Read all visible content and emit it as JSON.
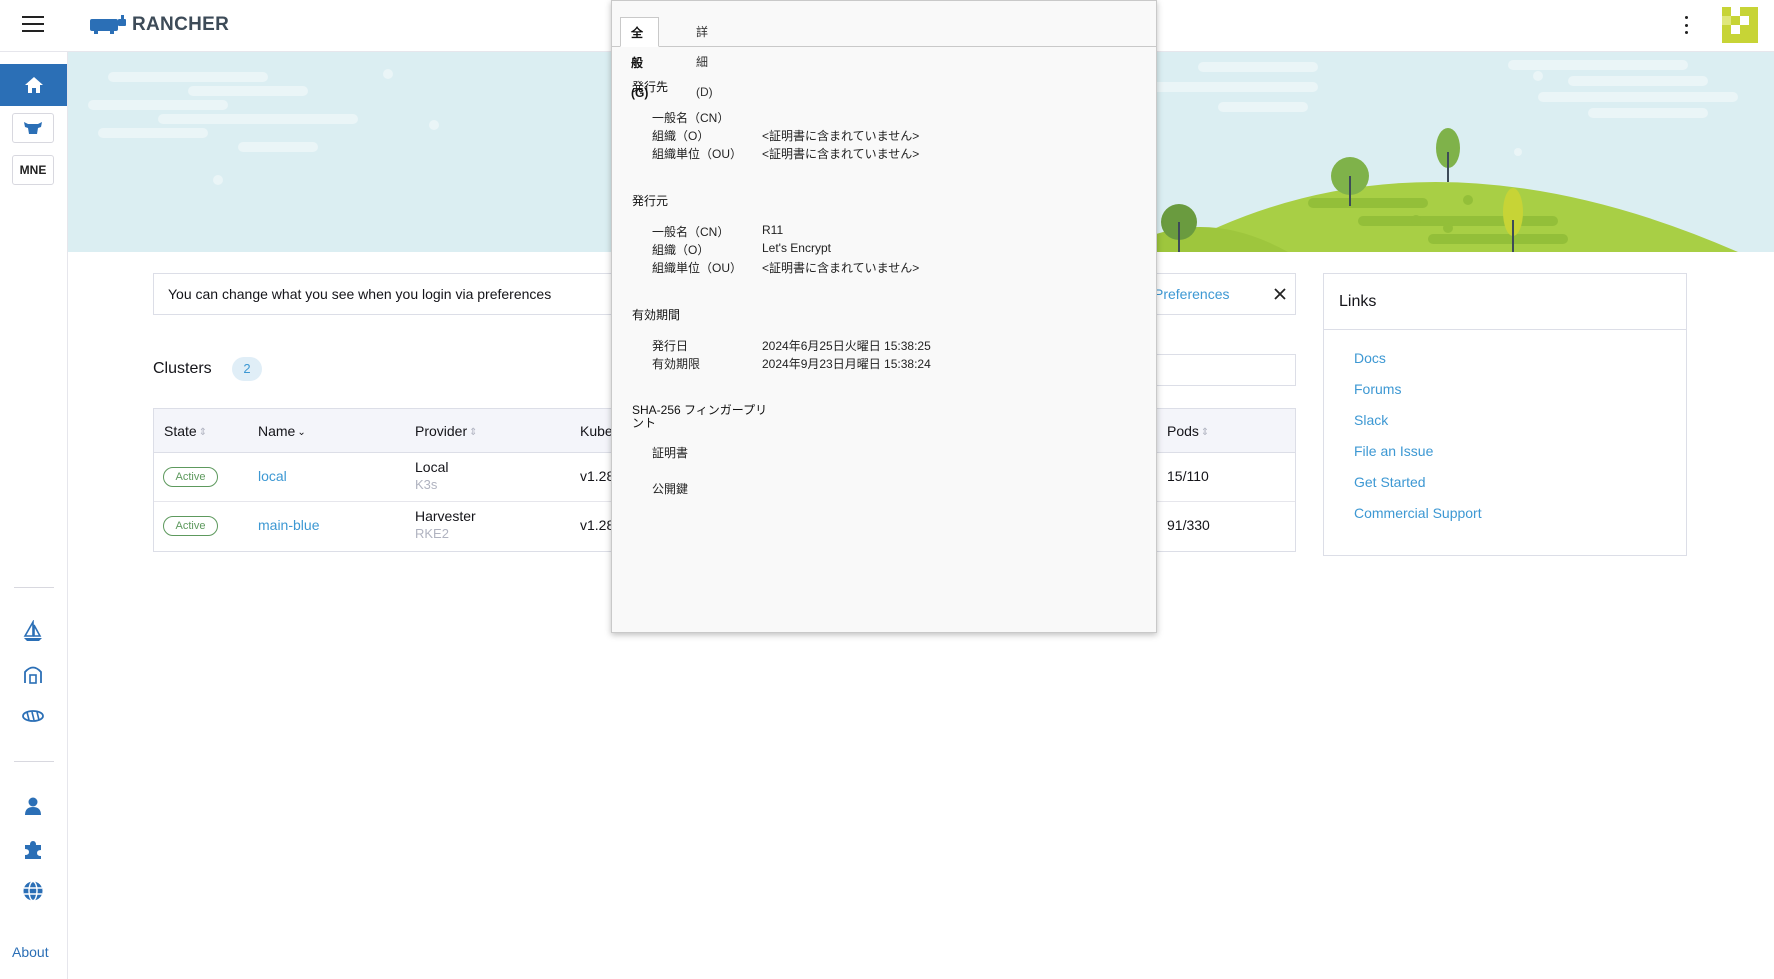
{
  "topbar": {
    "logo_text": "RANCHER"
  },
  "sidebar": {
    "items": [
      {
        "name": "home",
        "label": ""
      },
      {
        "name": "local-cluster",
        "label": ""
      },
      {
        "name": "mne-cluster",
        "label": "MNE"
      }
    ],
    "about_label": "About"
  },
  "notice": {
    "text": "You can change what you see when you login via preferences",
    "link": "Preferences"
  },
  "clusters": {
    "title": "Clusters",
    "count": "2",
    "columns": [
      "State",
      "Name",
      "Provider",
      "Kube",
      "Pods"
    ],
    "rows": [
      {
        "state": "Active",
        "name": "local",
        "provider": "Local",
        "provider_sub": "K3s",
        "kube": "v1.28",
        "pods": "15/110"
      },
      {
        "state": "Active",
        "name": "main-blue",
        "provider": "Harvester",
        "provider_sub": "RKE2",
        "kube": "v1.28",
        "pods": "91/330"
      }
    ]
  },
  "links": {
    "title": "Links",
    "items": [
      "Docs",
      "Forums",
      "Slack",
      "File an Issue",
      "Get Started",
      "Commercial Support"
    ]
  },
  "certificate": {
    "tabs": [
      "全般(G)",
      "詳細(D)"
    ],
    "issued_to": {
      "heading": "発行先",
      "fields": [
        {
          "k": "一般名（CN）",
          "v": ""
        },
        {
          "k": "組織（O）",
          "v": "<証明書に含まれていません>"
        },
        {
          "k": "組織単位（OU）",
          "v": "<証明書に含まれていません>"
        }
      ]
    },
    "issued_by": {
      "heading": "発行元",
      "fields": [
        {
          "k": "一般名（CN）",
          "v": "R11"
        },
        {
          "k": "組織（O）",
          "v": "Let's Encrypt"
        },
        {
          "k": "組織単位（OU）",
          "v": "<証明書に含まれていません>"
        }
      ]
    },
    "validity": {
      "heading": "有効期間",
      "fields": [
        {
          "k": "発行日",
          "v": "2024年6月25日火曜日 15:38:25"
        },
        {
          "k": "有効期限",
          "v": "2024年9月23日月曜日 15:38:24"
        }
      ]
    },
    "fingerprint": {
      "heading_line1": "SHA-256 フィンガープリ",
      "heading_line2": "ント",
      "cert_label": "証明書",
      "key_label": "公開鍵"
    }
  },
  "colors": {
    "accent": "#2b6fb6",
    "link": "#3d98d3",
    "active_badge": "#5d995d",
    "banner": "#dbeef2",
    "hill": "#a8cf45"
  }
}
